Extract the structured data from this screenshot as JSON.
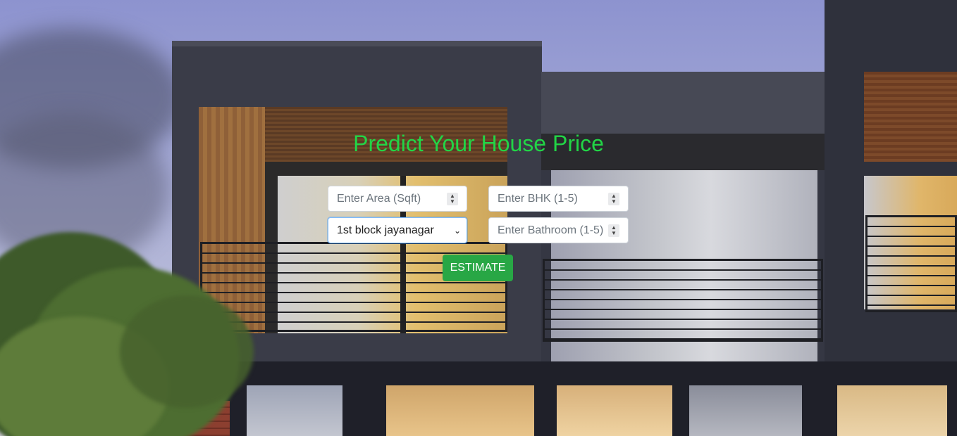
{
  "page": {
    "title": "Predict Your House Price"
  },
  "form": {
    "area": {
      "placeholder": "Enter Area (Sqft)",
      "value": ""
    },
    "bhk": {
      "placeholder": "Enter BHK (1-5)",
      "value": ""
    },
    "location": {
      "selected": "1st block jayanagar"
    },
    "bathroom": {
      "placeholder": "Enter Bathroom (1-5)",
      "value": ""
    },
    "estimate_label": "ESTIMATE"
  },
  "icons": {
    "stepper": "spinner-arrows-icon",
    "dropdown": "chevron-down-icon"
  },
  "colors": {
    "title": "#22d546",
    "button": "#28a745",
    "focus_border": "#80bdff"
  }
}
